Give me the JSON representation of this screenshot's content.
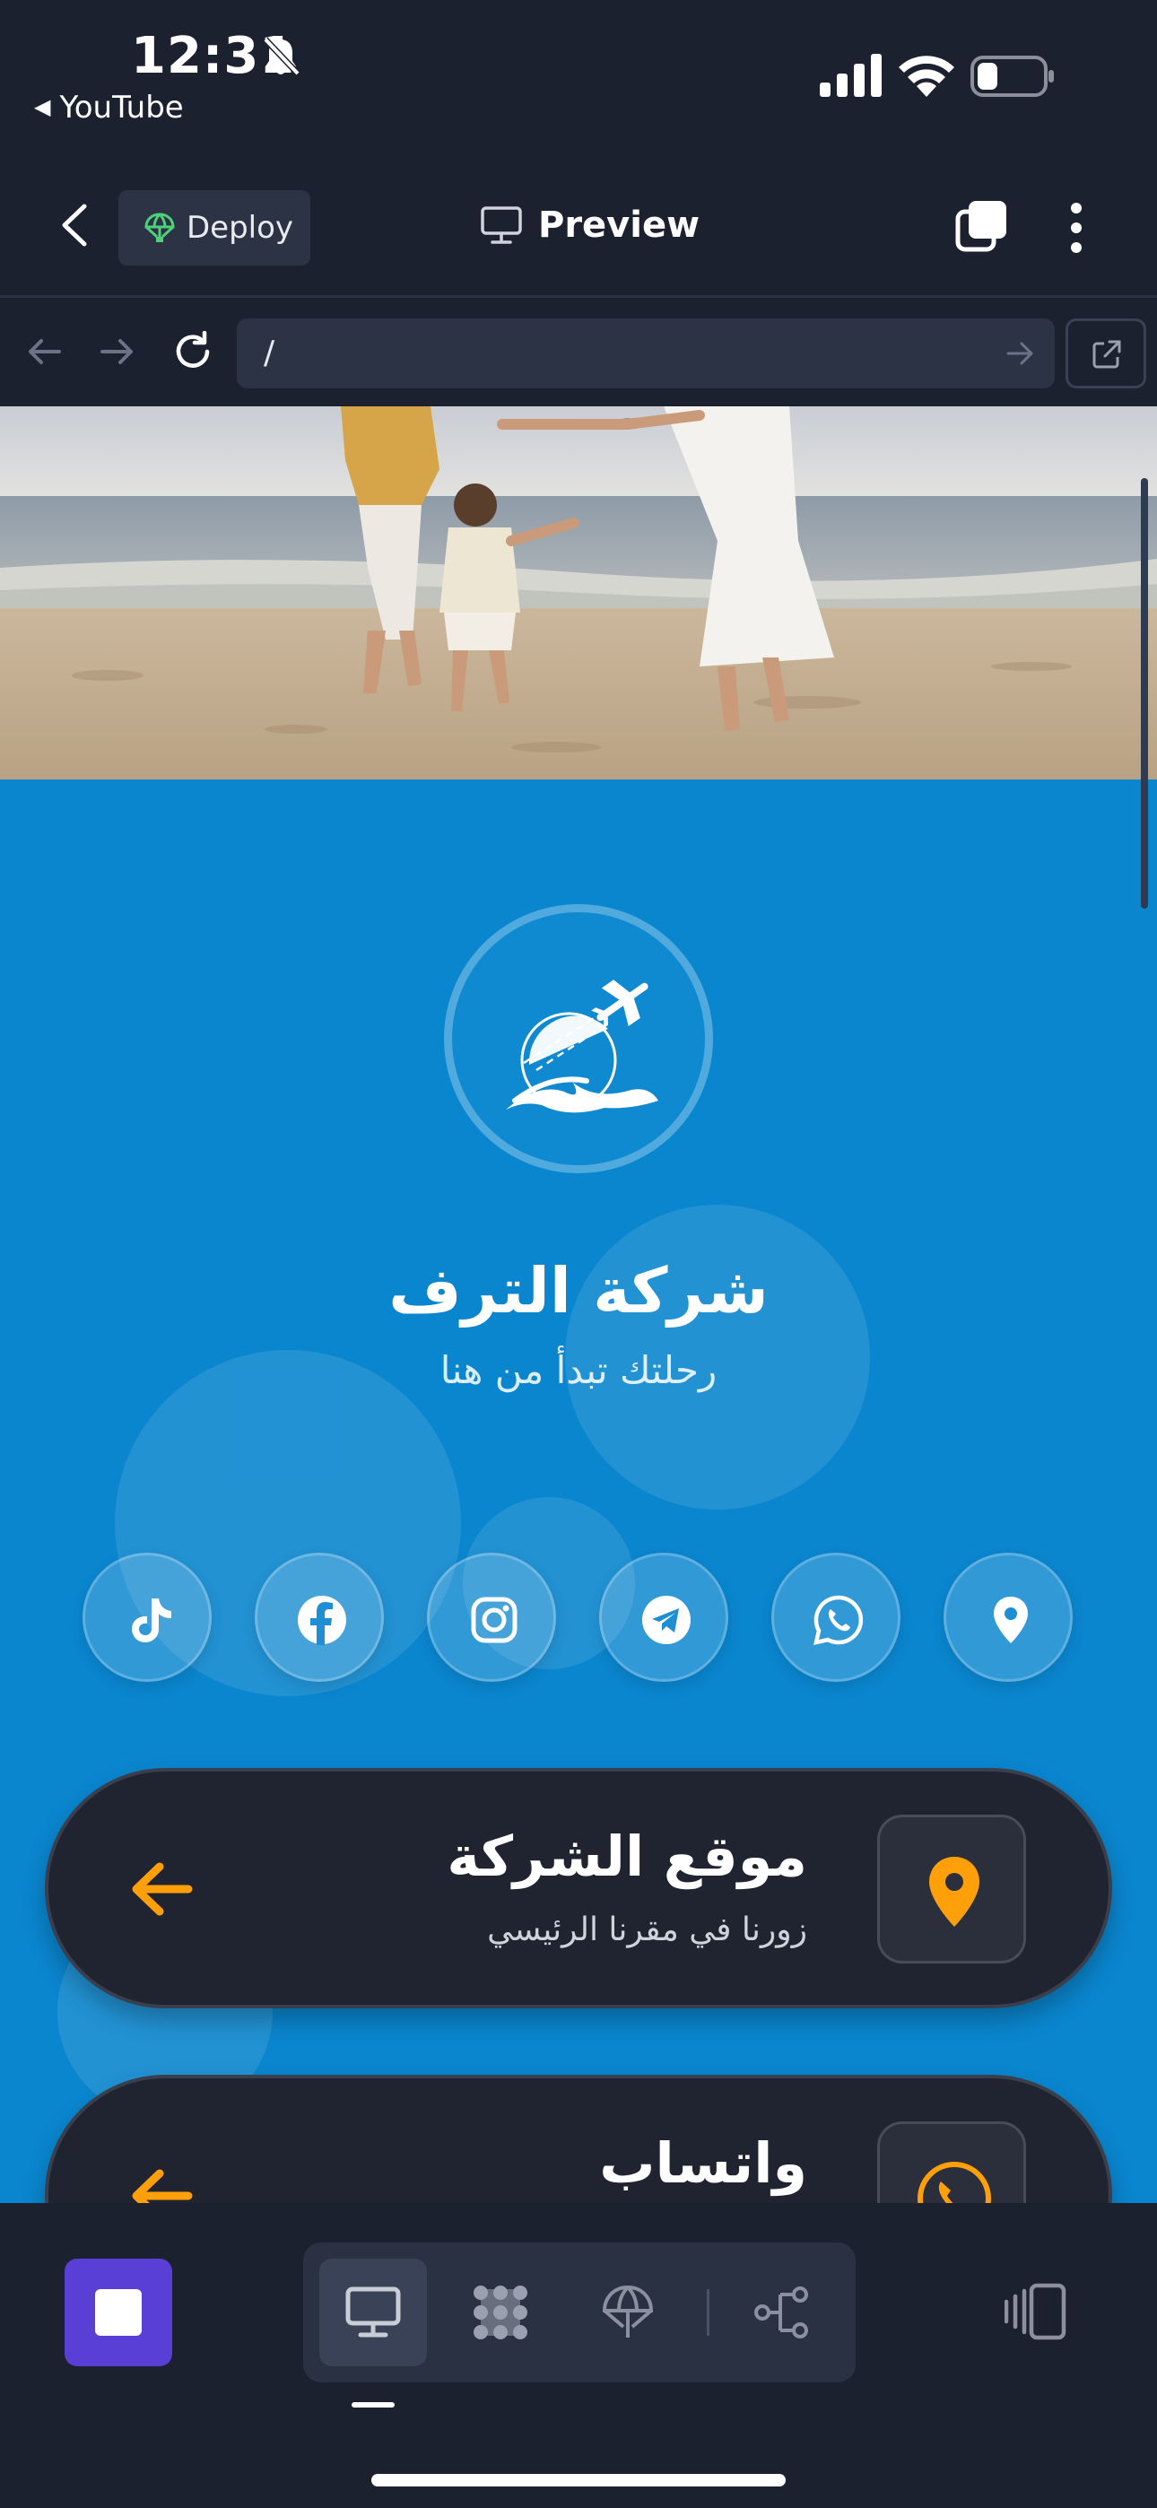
{
  "status_bar": {
    "time": "12:31",
    "back_app": "YouTube"
  },
  "app_header": {
    "deploy_label": "Deploy",
    "preview_label": "Preview"
  },
  "url_bar": {
    "path": "/"
  },
  "page": {
    "brand_title": "شركة الترف",
    "brand_subtitle": "رحلتك تبدأ من هنا",
    "social_icons": [
      "tiktok-icon",
      "facebook-icon",
      "instagram-icon",
      "telegram-icon",
      "whatsapp-icon",
      "location-pin-icon"
    ],
    "cards": [
      {
        "title": "موقع الشركة",
        "subtitle": "زورنا في مقرنا الرئيسي",
        "icon": "location-pin-icon"
      },
      {
        "title": "واتساب",
        "subtitle": "",
        "icon": "phone-icon"
      }
    ]
  },
  "colors": {
    "page_background": "#0a86cf",
    "card_background": "#1f2430",
    "accent_orange": "#ff9f0a",
    "app_chrome": "#1c2130",
    "stop_button": "#5a3fd6"
  }
}
